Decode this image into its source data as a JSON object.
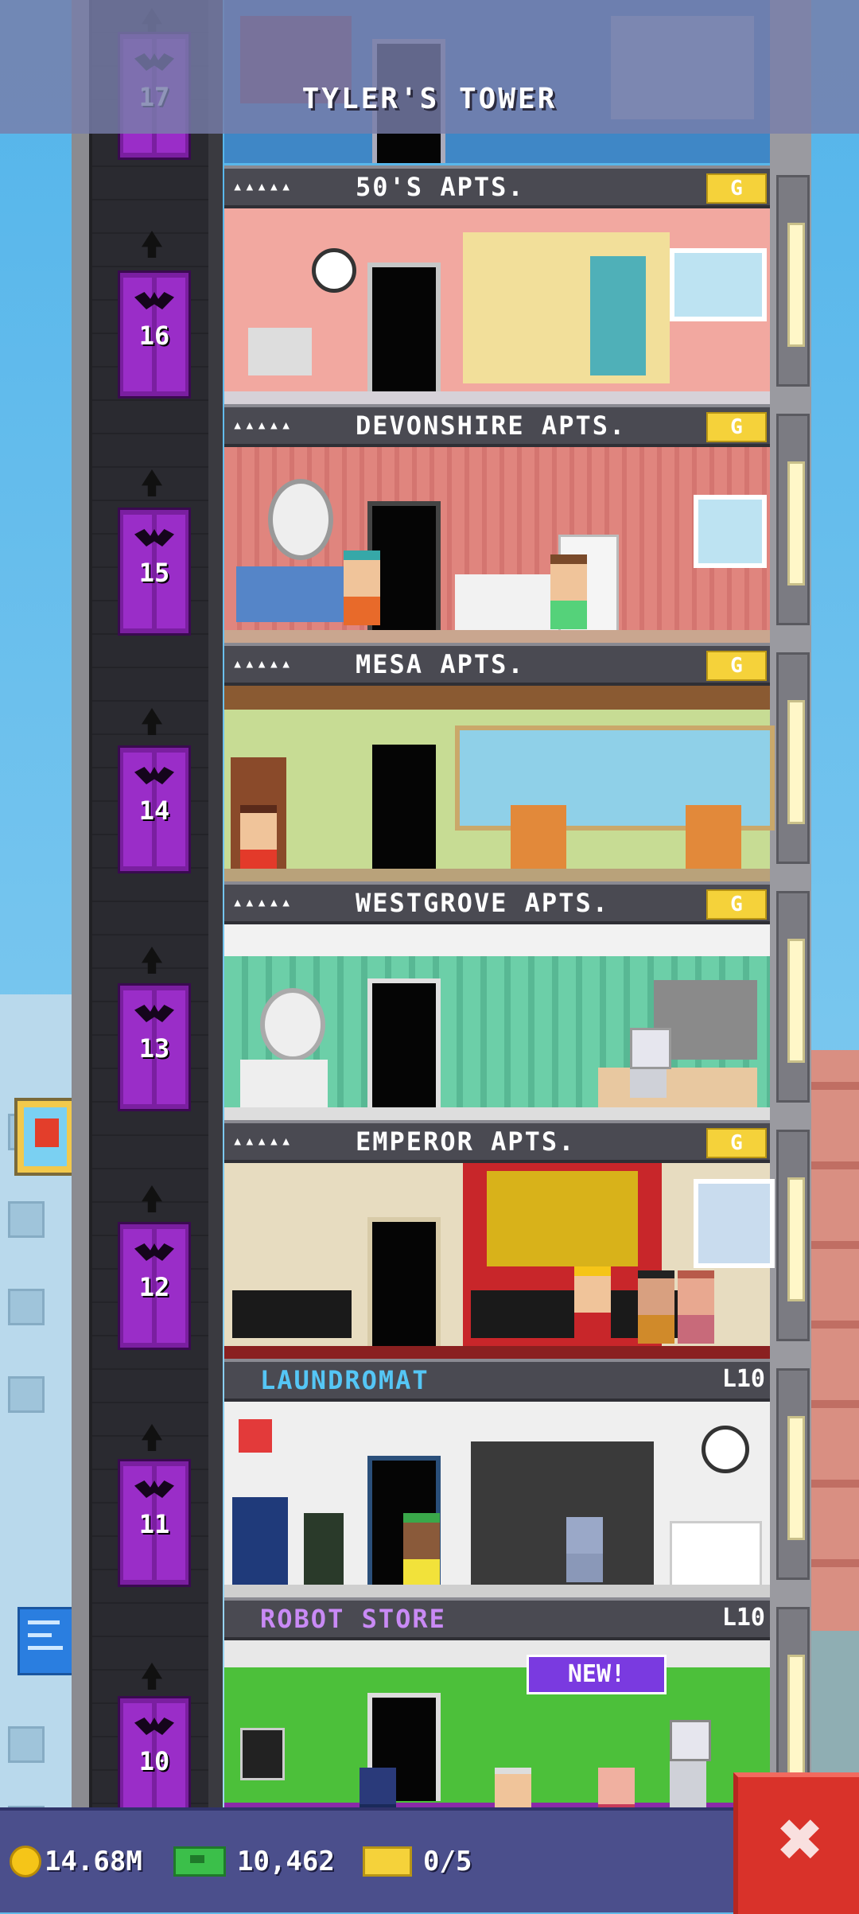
{
  "header": {
    "title": "TYLER'S TOWER"
  },
  "floors": {
    "f16": {
      "dots": "▴▴▴▴▴",
      "name": "50'S APTS.",
      "badge": "G"
    },
    "f15": {
      "dots": "▴▴▴▴▴",
      "name": "DEVONSHIRE APTS.",
      "badge": "G"
    },
    "f14": {
      "dots": "▴▴▴▴▴",
      "name": "MESA APTS.",
      "badge": "G"
    },
    "f13": {
      "dots": "▴▴▴▴▴",
      "name": "WESTGROVE APTS.",
      "badge": "G"
    },
    "f12": {
      "dots": "▴▴▴▴▴",
      "name": "EMPEROR APTS.",
      "badge": "G"
    },
    "f11": {
      "name": "LAUNDROMAT",
      "level": "L10"
    },
    "f10": {
      "name": "ROBOT STORE",
      "level": "L10",
      "new_badge": "NEW!"
    }
  },
  "elevator": {
    "floors": [
      "17",
      "16",
      "15",
      "14",
      "13",
      "12",
      "11",
      "10"
    ]
  },
  "footer": {
    "coins": "14.68M",
    "bux": "10,462",
    "tickets": "0/5",
    "close_label": "✖"
  },
  "colors": {
    "header_bg": "#787eaa",
    "footer_bg": "#4b4f8c",
    "close_button": "#d9322a",
    "elevator": "#7a1fa0",
    "gold_badge": "#f5d23a"
  }
}
